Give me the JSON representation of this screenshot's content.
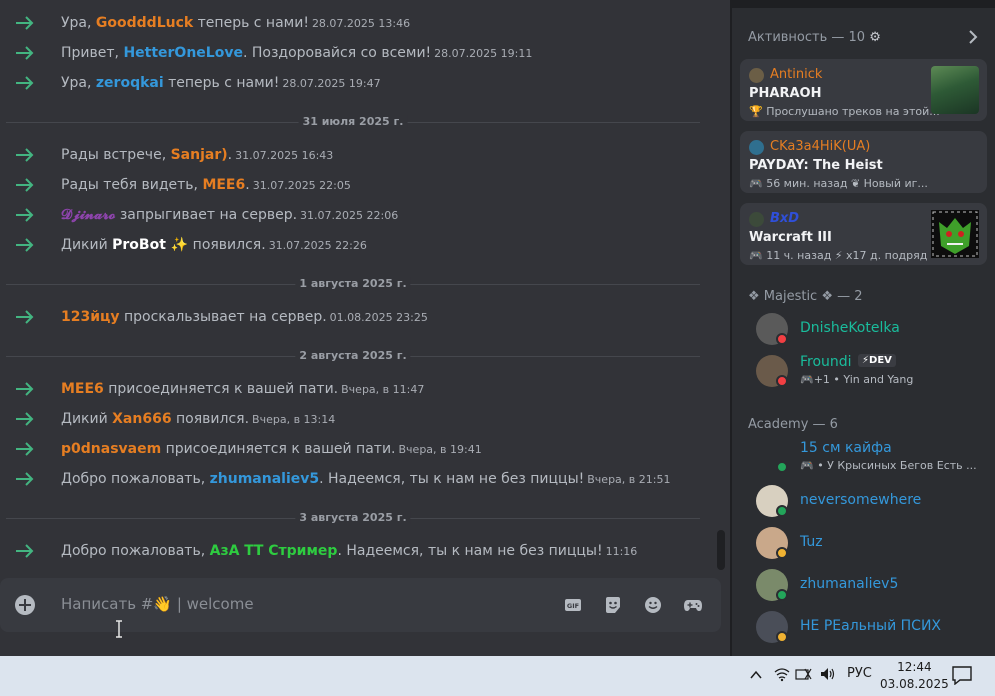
{
  "colors": {
    "accent_green": "#43b581",
    "orange_user": "#e67e22",
    "blue_user": "#3498db",
    "purple_user": "#8e44ad",
    "teal_user": "#1abc9c",
    "green_user": "#2ecc40"
  },
  "messages": [
    {
      "pre": "Ура, ",
      "user": "GoodddLuck",
      "color": "#e67e22",
      "post": " теперь с нами!",
      "ts": "28.07.2025 13:46"
    },
    {
      "pre": "Привет, ",
      "user": "HetterOneLove",
      "color": "#3498db",
      "post": ". Поздоровайся со всеми!",
      "ts": "28.07.2025 19:11"
    },
    {
      "pre": "Ура, ",
      "user": "zeroqkai",
      "color": "#3498db",
      "post": " теперь с нами!",
      "ts": "28.07.2025 19:47"
    },
    {
      "divider": "31 июля 2025 г."
    },
    {
      "pre": "Рады встрече, ",
      "user": "Sanjar)",
      "color": "#e67e22",
      "post": ".",
      "ts": "31.07.2025 16:43"
    },
    {
      "pre": "Рады тебя видеть, ",
      "user": "MEE6",
      "color": "#e67e22",
      "post": ".",
      "ts": "31.07.2025 22:05"
    },
    {
      "pre": "",
      "user": "𝓓𝓳𝓲𝓷𝓪𝓻𝓸",
      "color": "#8e44ad",
      "post": " запрыгивает на сервер.",
      "ts": "31.07.2025 22:06"
    },
    {
      "pre": "Дикий ",
      "user": "ProBot ✨",
      "color": "#ffffff",
      "post": " появился.",
      "ts": "31.07.2025 22:26"
    },
    {
      "divider": "1 августа 2025 г."
    },
    {
      "pre": "",
      "user": "123йцу",
      "color": "#e67e22",
      "post": " проскальзывает на сервер.",
      "ts": "01.08.2025 23:25"
    },
    {
      "divider": "2 августа 2025 г."
    },
    {
      "pre": "",
      "user": "MEE6",
      "color": "#e67e22",
      "post": " присоединяется к вашей пати.",
      "ts": "Вчера, в 11:47"
    },
    {
      "pre": "Дикий ",
      "user": "Xan666",
      "color": "#e67e22",
      "post": " появился.",
      "ts": "Вчера, в 13:14"
    },
    {
      "pre": "",
      "user": "p0dnasvaem",
      "color": "#e67e22",
      "post": " присоединяется к вашей пати.",
      "ts": "Вчера, в 19:41"
    },
    {
      "pre": "Добро пожаловать, ",
      "user": "zhumanaliev5",
      "color": "#3498db",
      "post": ". Надеемся, ты к нам не без пиццы!",
      "ts": "Вчера, в 21:51"
    },
    {
      "divider": "3 августа 2025 г."
    },
    {
      "pre": "Добро пожаловать, ",
      "user": "АзА ТТ Стример",
      "color": "#2ecc40",
      "post": ". Надеемся, ты к нам не без пиццы!",
      "ts": "11:16"
    }
  ],
  "composer": {
    "placeholder": "Написать #👋 | welcome",
    "tools": [
      "gif-icon",
      "sticker-icon",
      "emoji-icon",
      "gamepad-icon"
    ],
    "gif_label": "GIF"
  },
  "activity": {
    "header": "Активность — 10",
    "cards": [
      {
        "user": "Antinick",
        "game": "PHARAOH",
        "detail": "🏆 Прослушано треков на этой...",
        "thumb_color": "#2e5a36"
      },
      {
        "user": "CKa3a4HiK(UA)",
        "game": "PAYDAY: The Heist",
        "detail": "🎮 56 мин. назад  ❦ Новый иг...",
        "thumb_color": ""
      },
      {
        "user": "BxD",
        "game": "Warcraft III",
        "detail": "🎮 11 ч. назад  ⚡ x17 д. подряд",
        "thumb_color": "#1e3a12"
      }
    ]
  },
  "groups": [
    {
      "header": "❖ Majestic ❖ — 2",
      "members": [
        {
          "name": "DnisheKotelka",
          "color": "#1abc9c",
          "sub": "",
          "status": "#f23f43"
        },
        {
          "name": "Froundi",
          "color": "#1abc9c",
          "badge": "⚡DEV",
          "sub": "🎮+1 • Yin and Yang",
          "status": "#f23f43"
        }
      ]
    },
    {
      "header": "Academy — 6",
      "members": [
        {
          "name": "15 см кайфа",
          "color": "#3498db",
          "sub": "🎮 • У Крысиных Бегов Есть ...",
          "status": "#23a55a"
        },
        {
          "name": "neversomewhere",
          "color": "#3498db",
          "sub": "",
          "status": "#23a55a"
        },
        {
          "name": "Tuz",
          "color": "#3498db",
          "sub": "",
          "status": "#f0b232"
        },
        {
          "name": "zhumanaliev5",
          "color": "#3498db",
          "sub": "",
          "status": "#23a55a"
        },
        {
          "name": "НЕ РЕальный ПСИХ",
          "color": "#3498db",
          "sub": "",
          "status": "#f0b232"
        }
      ]
    }
  ],
  "taskbar": {
    "lang": "РУС",
    "time": "12:44",
    "date": "03.08.2025"
  }
}
